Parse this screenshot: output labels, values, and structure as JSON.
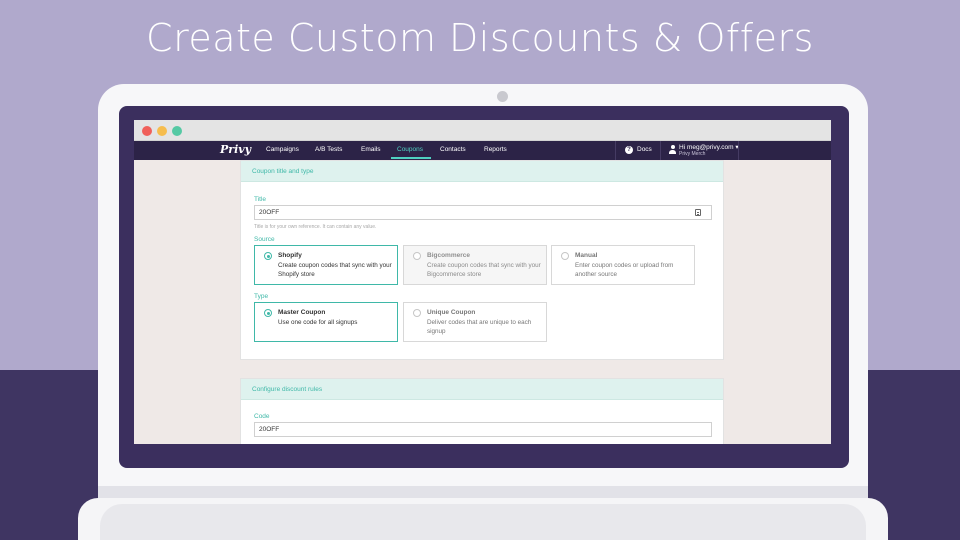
{
  "slide": {
    "title": "Create Custom Discounts & Offers"
  },
  "nav": {
    "logo": "Privy",
    "items": [
      {
        "label": "Campaigns"
      },
      {
        "label": "A/B Tests"
      },
      {
        "label": "Emails"
      },
      {
        "label": "Coupons"
      },
      {
        "label": "Contacts"
      },
      {
        "label": "Reports"
      }
    ],
    "active": "Coupons",
    "docs_label": "Docs",
    "user_email": "Hi meg@privy.com",
    "user_store": "Privy Merch",
    "user_menu_icon": "chevron-down-icon"
  },
  "coupon_card": {
    "header": "Coupon title and type",
    "title_label": "Title",
    "title_value": "20OFF",
    "title_help": "Title is for your own reference. It can contain any value.",
    "source_label": "Source",
    "sources": [
      {
        "title": "Shopify",
        "desc": "Create coupon codes that sync with your Shopify store",
        "state": "selected"
      },
      {
        "title": "Bigcommerce",
        "desc": "Create coupon codes that sync with your Bigcommerce store",
        "state": "disabled"
      },
      {
        "title": "Manual",
        "desc": "Enter coupon codes or upload from another source",
        "state": "unselected"
      }
    ],
    "type_label": "Type",
    "types": [
      {
        "title": "Master Coupon",
        "desc": "Use one code for all signups",
        "state": "selected"
      },
      {
        "title": "Unique Coupon",
        "desc": "Deliver codes that are unique to each signup",
        "state": "unselected"
      }
    ]
  },
  "discount_card": {
    "header": "Configure discount rules",
    "code_label": "Code",
    "code_value": "20OFF"
  },
  "colors": {
    "accent": "#3fb8a8",
    "nav_bg": "#2c2347",
    "slide_bg_top": "#b0a9cc",
    "slide_bg_bottom": "#3f3562"
  }
}
